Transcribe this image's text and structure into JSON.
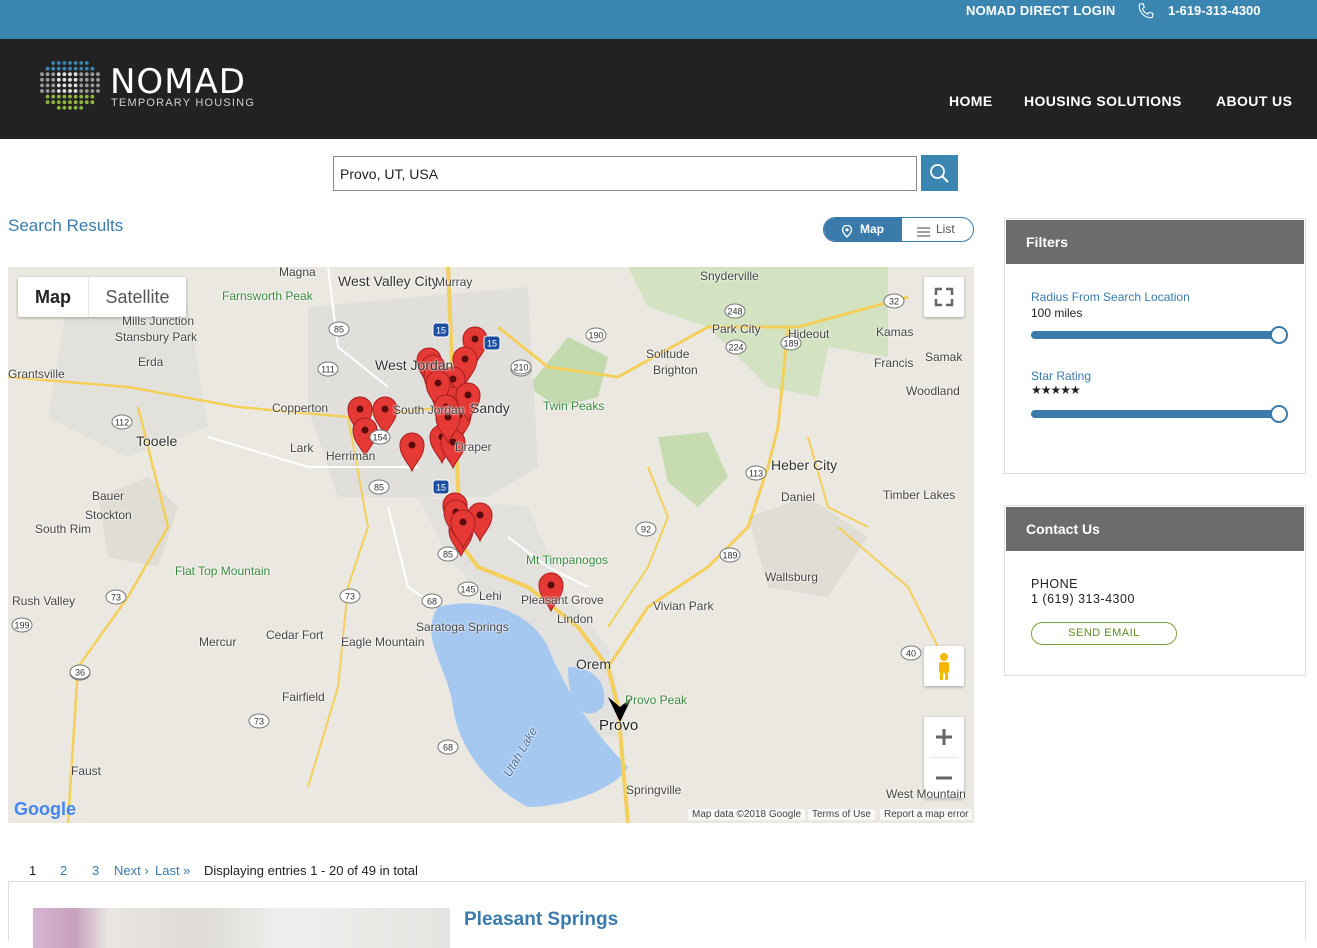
{
  "topbar": {
    "login_label": "NOMAD DIRECT LOGIN",
    "phone": "1-619-313-4300"
  },
  "brand": {
    "name": "NOMAD",
    "tagline": "TEMPORARY HOUSING"
  },
  "nav": [
    {
      "label": "HOME"
    },
    {
      "label": "HOUSING SOLUTIONS"
    },
    {
      "label": "ABOUT US"
    }
  ],
  "search": {
    "value": "Provo, UT, USA"
  },
  "results": {
    "title": "Search Results"
  },
  "view_toggle": {
    "map_label": "Map",
    "list_label": "List",
    "active": "Map"
  },
  "map": {
    "type_map": "Map",
    "type_satellite": "Satellite",
    "labels": [
      "Magna",
      "West Valley City",
      "Murray",
      "Snyderville",
      "Farnsworth Peak",
      "Mills Junction",
      "Stansbury Park",
      "Erda",
      "West Jordan",
      "Park City",
      "Hideout",
      "Kamas",
      "Grantsville",
      "Solitude",
      "Brighton",
      "Samak",
      "Francis",
      "Copperton",
      "South Jordan",
      "Sandy",
      "Twin Peaks",
      "Woodland",
      "Tooele",
      "Lark",
      "Herriman",
      "Draper",
      "Heber City",
      "Bauer",
      "Daniel",
      "Timber Lakes",
      "Stockton",
      "South Rim",
      "Mt Timpanogos",
      "Lehi",
      "Flat Top Mountain",
      "Wallsburg",
      "Pleasant Grove",
      "Rush Valley",
      "Vivian Park",
      "Saratoga Springs",
      "Lindon",
      "Mercur",
      "Cedar Fort",
      "Eagle Mountain",
      "Orem",
      "Provo Peak",
      "Fairfield",
      "Provo",
      "Utah Lake",
      "Faust",
      "Springville",
      "West Mountain"
    ],
    "route_shields": [
      "15",
      "15",
      "85",
      "111",
      "71",
      "248",
      "190",
      "224",
      "189",
      "32",
      "112",
      "36",
      "210",
      "15",
      "154",
      "85",
      "113",
      "92",
      "189",
      "85",
      "145",
      "73",
      "68",
      "73",
      "199",
      "36",
      "73",
      "68",
      "40"
    ],
    "footer": {
      "data": "Map data ©2018 Google",
      "terms": "Terms of Use",
      "report": "Report a map error"
    },
    "google_logo": "Google",
    "marker_count": 25
  },
  "filters": {
    "title": "Filters",
    "radius": {
      "label": "Radius From Search Location",
      "value": "100 miles",
      "fraction": 1.0
    },
    "stars": {
      "label": "Star Rating",
      "value": "★★★★★",
      "fraction": 1.0
    }
  },
  "contact": {
    "title": "Contact Us",
    "phone_label": "PHONE",
    "phone": "1 (619) 313-4300",
    "send_label": "SEND EMAIL"
  },
  "pagination": {
    "pages": [
      "1",
      "2",
      "3"
    ],
    "next": "Next ›",
    "last": "Last »",
    "summary": "Displaying entries 1 - 20 of 49 in total"
  },
  "listing": {
    "title": "Pleasant Springs"
  },
  "colors": {
    "primary": "#3a86b0",
    "header_bg": "#222222",
    "panel_header": "#6c6c6c",
    "marker": "#e53935",
    "accent_green": "#7aa23a"
  }
}
